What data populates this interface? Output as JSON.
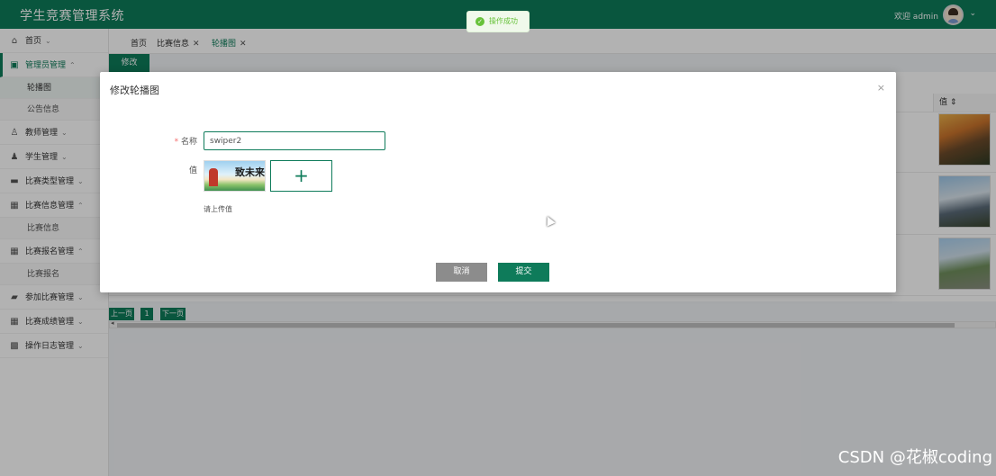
{
  "header": {
    "title": "学生竞赛管理系统",
    "welcome": "欢迎 admin",
    "caret": "⌄"
  },
  "toast": {
    "text": "操作成功"
  },
  "sidebar": {
    "items": [
      {
        "label": "首页",
        "icon": "home-icon",
        "arrow": "⌄"
      },
      {
        "label": "管理员管理",
        "icon": "admin-icon",
        "arrow": "⌃",
        "active": true
      },
      {
        "label": "轮播图",
        "sub": true,
        "selected": true
      },
      {
        "label": "公告信息",
        "sub": true
      },
      {
        "label": "教师管理",
        "icon": "teacher-icon",
        "arrow": "⌄"
      },
      {
        "label": "学生管理",
        "icon": "student-icon",
        "arrow": "⌄"
      },
      {
        "label": "比赛类型管理",
        "icon": "category-icon",
        "arrow": "⌄"
      },
      {
        "label": "比赛信息管理",
        "icon": "grid-icon",
        "arrow": "⌃"
      },
      {
        "label": "比赛信息",
        "sub": true
      },
      {
        "label": "比赛报名管理",
        "icon": "grid-icon",
        "arrow": "⌃"
      },
      {
        "label": "比赛报名",
        "sub": true
      },
      {
        "label": "参加比赛管理",
        "icon": "folder-icon",
        "arrow": "⌄"
      },
      {
        "label": "比赛成绩管理",
        "icon": "grid-icon",
        "arrow": "⌄"
      },
      {
        "label": "操作日志管理",
        "icon": "log-icon",
        "arrow": "⌄"
      }
    ]
  },
  "tabs": [
    {
      "label": "首页"
    },
    {
      "label": "比赛信息",
      "close": "✕"
    },
    {
      "label": "轮播图",
      "close": "✕"
    }
  ],
  "toolbar": {
    "edit_label": "修改"
  },
  "table": {
    "value_header": "值 ⇕"
  },
  "pager": {
    "prev": "上一页",
    "page": "1",
    "next": "下一页"
  },
  "modal": {
    "title": "修改轮播图",
    "close": "×",
    "name_label": "名称",
    "required_mark": "*",
    "name_value": "swiper2",
    "value_label": "值",
    "upload_plus": "+",
    "image_text": "致未来",
    "upload_hint": "请上传值",
    "cancel_label": "取消",
    "submit_label": "提交"
  },
  "watermark": "CSDN @花椒coding",
  "colors": {
    "primary": "#0e7b5a",
    "success": "#67c23a",
    "cancel": "#8c8c8c"
  }
}
